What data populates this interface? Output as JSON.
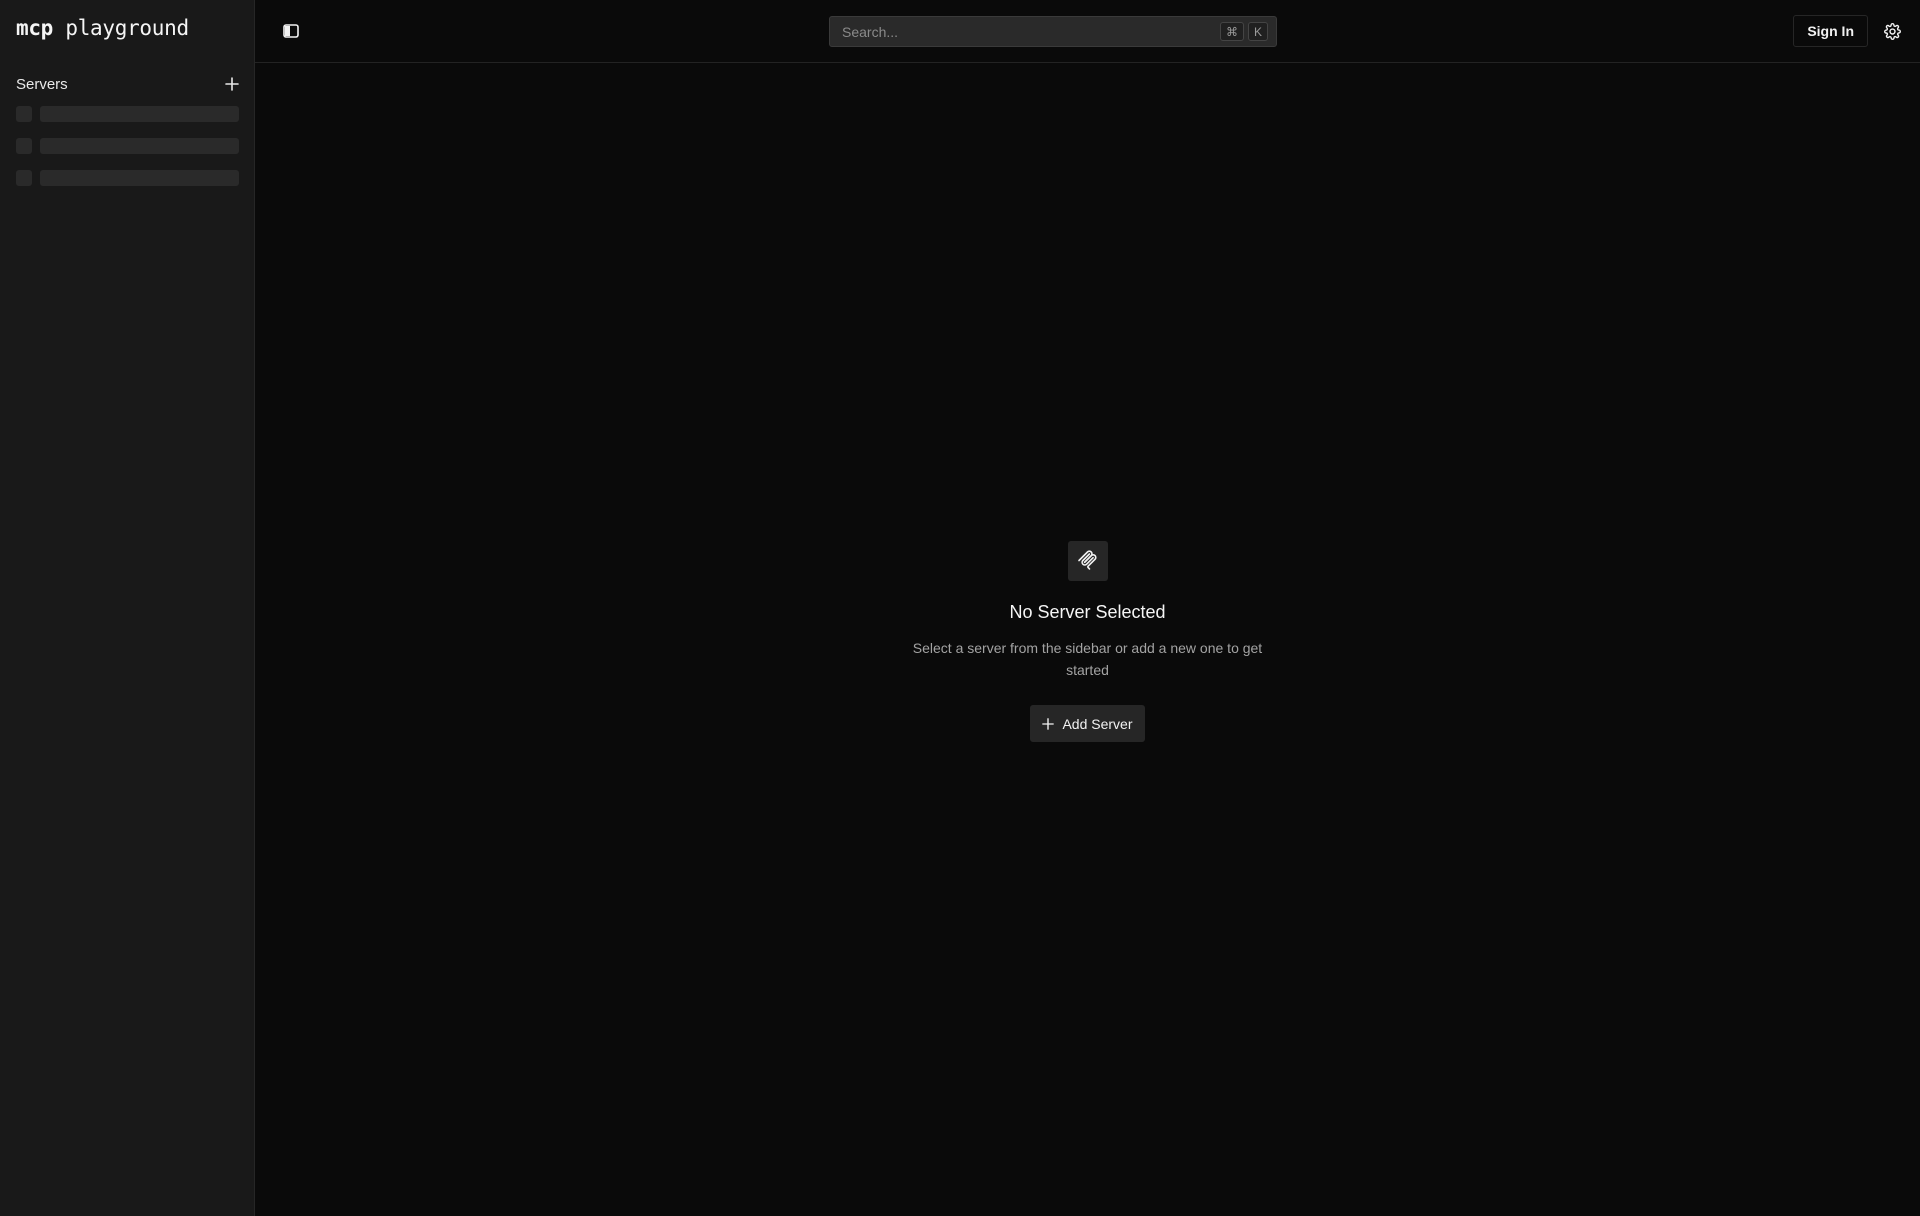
{
  "sidebar": {
    "logo_bold": "mcp",
    "logo_rest": "playground",
    "servers_label": "Servers",
    "add_icon": "plus-icon",
    "skeleton_rows": 3
  },
  "topbar": {
    "toggle_icon": "sidebar-toggle-icon",
    "search_placeholder": "Search...",
    "shortcut_keys": [
      "⌘",
      "K"
    ],
    "sign_in_label": "Sign In",
    "settings_icon": "gear-icon"
  },
  "empty_state": {
    "icon": "mcp-logo-icon",
    "title": "No Server Selected",
    "description": "Select a server from the sidebar or add a new one to get started",
    "add_button_label": "Add Server"
  },
  "colors": {
    "background": "#0a0a0a",
    "sidebar": "#191919",
    "surface": "#262626",
    "text": "#f2f2f2",
    "muted": "#a3a3a3"
  }
}
